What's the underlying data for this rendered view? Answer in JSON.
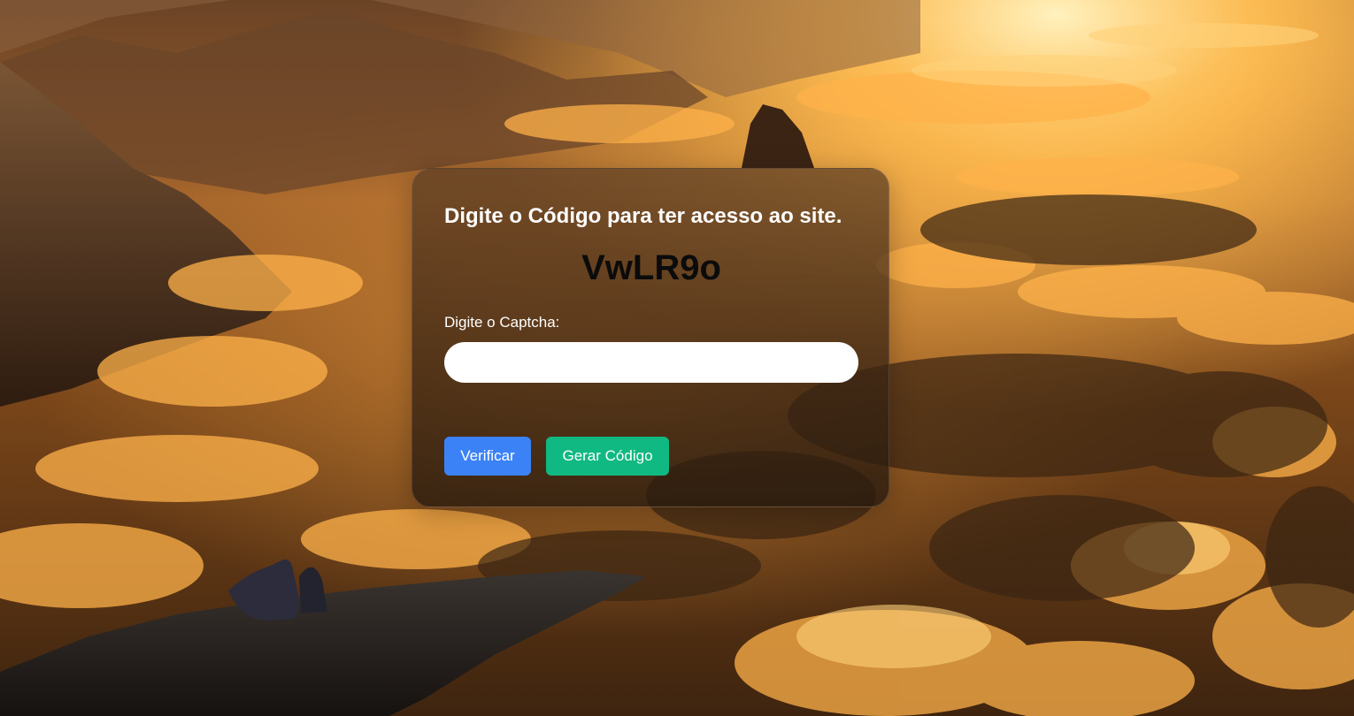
{
  "page": {
    "accent_verify": "#3b82f6",
    "accent_generate": "#10b981"
  },
  "captcha_card": {
    "title": "Digite o Código para ter acesso ao site.",
    "code": "VwLR9o",
    "input_label": "Digite o Captcha:",
    "input_value": "",
    "input_placeholder": "",
    "verify_label": "Verificar",
    "generate_label": "Gerar Código"
  }
}
